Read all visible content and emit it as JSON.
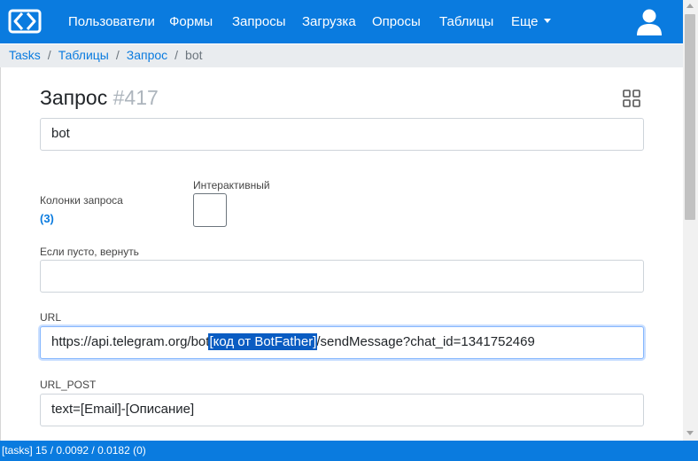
{
  "nav": {
    "items": [
      "Пользователи",
      "Формы",
      "Запросы",
      "Загрузка",
      "Опросы",
      "Таблицы",
      "Еще"
    ]
  },
  "breadcrumb": [
    "Tasks",
    "Таблицы",
    "Запрос",
    "bot"
  ],
  "page": {
    "title_prefix": "Запрос",
    "title_number": "#417",
    "name_value": "bot"
  },
  "columns": {
    "label": "Колонки запроса",
    "count": "(3)"
  },
  "interactive": {
    "label": "Интерактивный",
    "checked": false
  },
  "if_empty": {
    "label": "Если пусто, вернуть",
    "value": ""
  },
  "url": {
    "label": "URL",
    "before": "https://api.telegram.org/bot",
    "selected": "[код от BotFather]",
    "after": "/sendMessage?chat_id=1341752469"
  },
  "url_post": {
    "label": "URL_POST",
    "value": "text=[Email]-[Описание]"
  },
  "status": {
    "text": "[tasks] 15 / 0.0092 / 0.0182 (0)"
  },
  "colors": {
    "brand": "#0a7bdf",
    "selection": "#0a5cc2"
  }
}
